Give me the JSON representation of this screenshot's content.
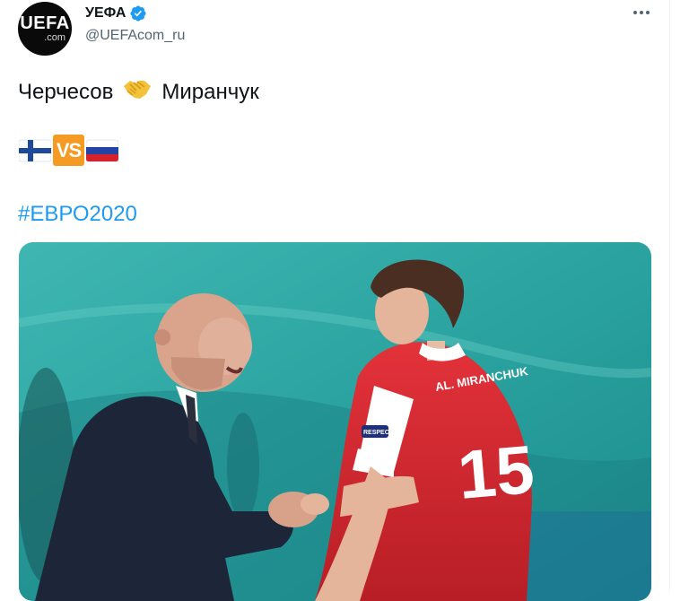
{
  "tweet": {
    "avatar": {
      "line1": "UEFA",
      "line2": ".com"
    },
    "display_name": "УЕФА",
    "verified_icon": "verified-badge-icon",
    "handle": "@UEFAcom_ru",
    "more_icon": "more-dots-icon",
    "text": {
      "word1": "Черчесов",
      "emoji1": "handshake-emoji",
      "word2": "Миранчук"
    },
    "flags": {
      "left": "finland-flag-emoji",
      "vs": "VS",
      "right": "russia-flag-emoji"
    },
    "hashtag": "#ЕВРО2020",
    "photo": {
      "jersey_name": "AL. MIRANCHUK",
      "jersey_number": "15",
      "sleeve_badge": "RESPECT"
    }
  },
  "colors": {
    "link": "#1d9bf0",
    "secondary_text": "#536471",
    "vs_badge": "#f59a23",
    "jersey_red": "#d9272e",
    "stadium_teal": "#2aa3a0"
  }
}
